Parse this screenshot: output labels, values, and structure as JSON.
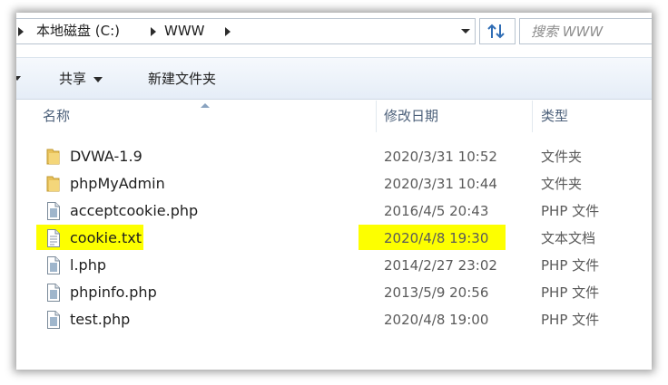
{
  "address_bar": {
    "crumbs": [
      "本地磁盘 (C:)",
      "WWW"
    ],
    "search_placeholder": "搜索 WWW"
  },
  "toolbar": {
    "share_label": "共享",
    "new_folder_label": "新建文件夹"
  },
  "columns": {
    "name": "名称",
    "date_modified": "修改日期",
    "type": "类型"
  },
  "files": [
    {
      "name": "DVWA-1.9",
      "date": "2020/3/31 10:52",
      "type": "文件夹",
      "icon": "folder-icon"
    },
    {
      "name": "phpMyAdmin",
      "date": "2020/3/31 10:44",
      "type": "文件夹",
      "icon": "folder-icon"
    },
    {
      "name": "acceptcookie.php",
      "date": "2016/4/5 20:43",
      "type": "PHP 文件",
      "icon": "php-file-icon"
    },
    {
      "name": "cookie.txt",
      "date": "2020/4/8 19:30",
      "type": "文本文档",
      "icon": "text-file-icon",
      "highlighted": true
    },
    {
      "name": "l.php",
      "date": "2014/2/27 23:02",
      "type": "PHP 文件",
      "icon": "php-file-icon"
    },
    {
      "name": "phpinfo.php",
      "date": "2013/5/9 20:56",
      "type": "PHP 文件",
      "icon": "php-file-icon"
    },
    {
      "name": "test.php",
      "date": "2020/4/8 19:00",
      "type": "PHP 文件",
      "icon": "php-file-icon"
    }
  ],
  "colors": {
    "highlight": "#fdff00",
    "folder": "#e8c15a",
    "toolbar_top": "#f6f9fd",
    "toolbar_bottom": "#e5edf7",
    "column_text": "#4c607a"
  }
}
